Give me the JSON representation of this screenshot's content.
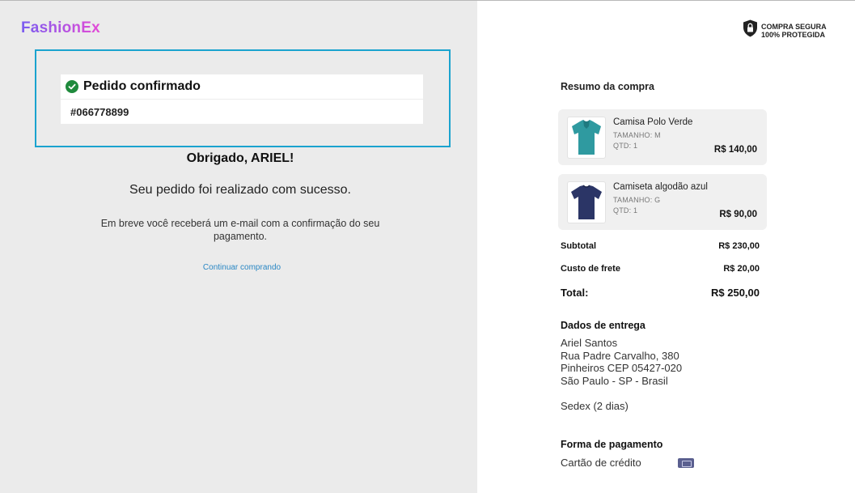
{
  "brand": {
    "logo_text": "FashionEx",
    "gradient": [
      "#7a5cf0",
      "#e44bd6"
    ]
  },
  "confirmation": {
    "title": "Pedido confirmado",
    "order_number": "#066778899",
    "thanks": "Obrigado, ARIEL!",
    "success_message": "Seu pedido foi realizado com sucesso.",
    "email_message": "Em breve você receberá um e-mail com a confirmação do seu pagamento.",
    "continue_link": "Continuar comprando",
    "highlight_color": "#1aa3cf",
    "check_color": "#1f8a3c"
  },
  "secure_badge": {
    "line1": "COMPRA SEGURA",
    "line2": "100% PROTEGIDA",
    "icon": "shield-lock-icon"
  },
  "summary": {
    "title": "Resumo da compra",
    "items": [
      {
        "name": "Camisa Polo Verde",
        "size": "TAMANHO: M",
        "qty": "QTD: 1",
        "price": "R$ 140,00",
        "image": "green-polo-shirt-image",
        "color": "#2f9aa0"
      },
      {
        "name": "Camiseta algodão azul",
        "size": "TAMANHO: G",
        "qty": "QTD: 1",
        "price": "R$ 90,00",
        "image": "blue-tshirt-image",
        "color": "#2b3566"
      }
    ],
    "subtotal_label": "Subtotal",
    "subtotal_value": "R$ 230,00",
    "shipping_label": "Custo de frete",
    "shipping_value": "R$ 20,00",
    "total_label": "Total:",
    "total_value": "R$ 250,00"
  },
  "delivery": {
    "title": "Dados de entrega",
    "lines": [
      "Ariel Santos",
      "Rua Padre Carvalho, 380",
      "Pinheiros CEP 05427-020",
      "São Paulo - SP - Brasil"
    ],
    "method": "Sedex (2 dias)"
  },
  "payment": {
    "title": "Forma de pagamento",
    "method": "Cartão de crédito",
    "icon": "credit-card-icon"
  }
}
